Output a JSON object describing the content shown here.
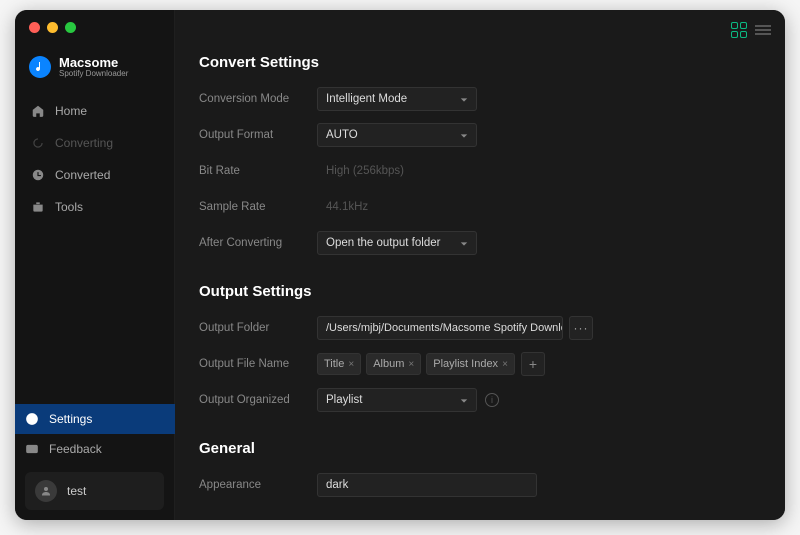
{
  "brand": {
    "name": "Macsome",
    "subtitle": "Spotify Downloader"
  },
  "sidebar": {
    "items": [
      {
        "label": "Home"
      },
      {
        "label": "Converting"
      },
      {
        "label": "Converted"
      },
      {
        "label": "Tools"
      }
    ],
    "bottom": [
      {
        "label": "Settings"
      },
      {
        "label": "Feedback"
      }
    ]
  },
  "user": {
    "name": "test"
  },
  "sections": {
    "convert": {
      "title": "Convert Settings",
      "rows": {
        "conversion_mode": {
          "label": "Conversion Mode",
          "value": "Intelligent Mode"
        },
        "output_format": {
          "label": "Output Format",
          "value": "AUTO"
        },
        "bit_rate": {
          "label": "Bit Rate",
          "value": "High (256kbps)"
        },
        "sample_rate": {
          "label": "Sample Rate",
          "value": "44.1kHz"
        },
        "after_converting": {
          "label": "After Converting",
          "value": "Open the output folder"
        }
      }
    },
    "output": {
      "title": "Output Settings",
      "rows": {
        "output_folder": {
          "label": "Output Folder",
          "value": "/Users/mjbj/Documents/Macsome Spotify Downloader"
        },
        "output_filename": {
          "label": "Output File Name",
          "tags": [
            "Title",
            "Album",
            "Playlist Index"
          ]
        },
        "output_organized": {
          "label": "Output Organized",
          "value": "Playlist"
        }
      }
    },
    "general": {
      "title": "General",
      "rows": {
        "appearance": {
          "label": "Appearance",
          "value": "dark"
        }
      }
    }
  },
  "icons": {
    "browse": "···",
    "add": "+",
    "remove": "×",
    "info": "i"
  }
}
